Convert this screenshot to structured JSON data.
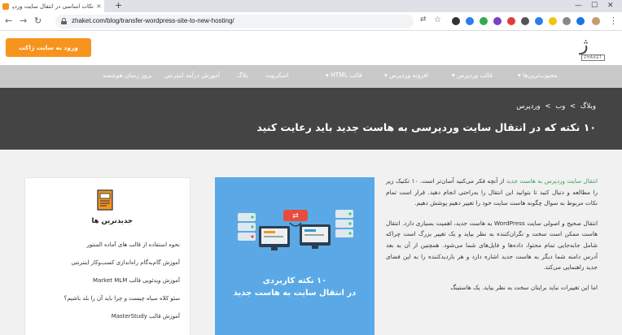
{
  "browser": {
    "tab_title": "نکات اساسی در انتقال سایت وردپرسی | ژاک...",
    "tab_close": "×",
    "new_tab": "+",
    "window_controls": [
      "—",
      "☐",
      "✕"
    ],
    "url": "zhaket.com/blog/transfer-wordpress-site-to-new-hosting/"
  },
  "header": {
    "cta_label": "ورود به سایت ژاکت",
    "logo_glyph": "ژاکت",
    "logo_sub": "ZHAKET"
  },
  "nav": {
    "items": [
      "محبوب‌ترین‌ها",
      "قالب وردپرس",
      "افزونه وردپرس",
      "قالب HTML",
      "اسکریپت",
      "بلاگ",
      "آموزش درآمد اینترنتی",
      "بروز رسان هوشمند"
    ]
  },
  "band": {
    "breadcrumb": [
      "وبلاگ",
      "وب",
      "وردپرس"
    ],
    "breadcrumb_sep": ">",
    "title": "۱۰ نکته که در انتقال سایت وردپرسی به هاست جدید باید رعایت کنید"
  },
  "sidebar": {
    "title": "جدیدترین ها",
    "items": [
      "نحوه استفاده از قالب های آماده المنتور",
      "آموزش گام‌به‌گام راه‌اندازی کسب‌وکار اینترنتی",
      "آموزش ویدئویی قالب Market MLM",
      "سئو کلاه سیاه چیست و چرا باید آن را بلد باشیم؟",
      "آموزش قالب MasterStudy"
    ]
  },
  "hero": {
    "line1": "۱۰ نکته کاربردی",
    "line2": "در انتقال سایت به هاست جدید"
  },
  "article": {
    "p1_link": "انتقال سایت وردپرس به هاست جدید",
    "p1_rest": " از آنچه فکر می‌کنید آسان‌تر است. ۱۰ تکنیک زیر را مطالعه و دنبال کنید تا بتوانید این انتقال را به‌راحتی انجام دهید. قرار است تمام نکات مربوط به سوال چگونه هاست سایت خود را تغییر دهیم پوشش دهیم.",
    "p2": "انتقال صحیح و اصولی سایت WordPress به هاست جدید، اهمیت بسیاری دارد. انتقال هاست ممکن است سخت و نگران‌کننده به نظر بیاید و یک تغییر بزرگ است چراکه شامل جابه‌جایی تمام محتوا، داده‌ها و فایل‌های شما می‌شود. همچنین از آن به بعد آدرس دامنه شما دیگر به هاست جدید اشاره دارد و هر بازدیدکننده را به این فضای جدید راهنمایی می‌کند.",
    "p3": "اما این تغییرات نباید برایتان سخت به نظر بیاید. یک هاستینگ"
  },
  "colors": {
    "accent": "#f7941d",
    "nav_bg": "#c9c9c9",
    "band_bg": "#444444",
    "hero_bg": "#5aa9e6",
    "link": "#3c9c53"
  },
  "icons": [
    "lock-icon",
    "back-arrow-icon",
    "forward-arrow-icon",
    "reload-icon",
    "star-icon",
    "translate-icon",
    "extension-icon",
    "profile-avatar-icon",
    "newspaper-icon",
    "server-icon",
    "monitor-icon"
  ]
}
